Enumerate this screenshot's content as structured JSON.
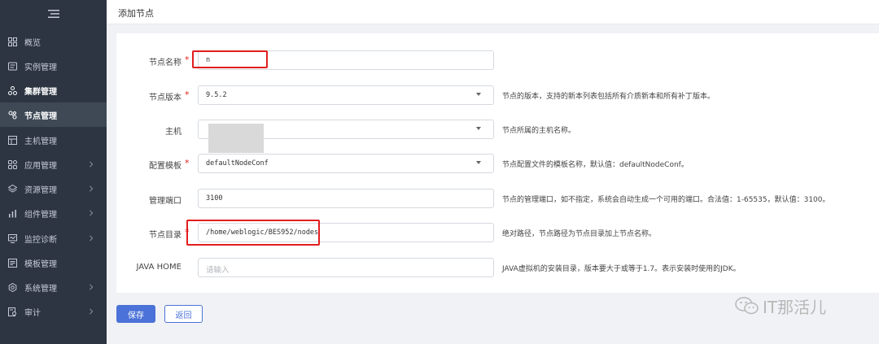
{
  "page_title": "添加节点",
  "sidebar": {
    "items": [
      {
        "label": "概览",
        "icon": "grid-icon",
        "chevron": false,
        "state": "normal"
      },
      {
        "label": "实例管理",
        "icon": "instance-icon",
        "chevron": false,
        "state": "normal"
      },
      {
        "label": "集群管理",
        "icon": "cluster-icon",
        "chevron": false,
        "state": "bold"
      },
      {
        "label": "节点管理",
        "icon": "node-icon",
        "chevron": false,
        "state": "active"
      },
      {
        "label": "主机管理",
        "icon": "host-icon",
        "chevron": false,
        "state": "normal"
      },
      {
        "label": "应用管理",
        "icon": "apps-icon",
        "chevron": true,
        "state": "normal"
      },
      {
        "label": "资源管理",
        "icon": "layers-icon",
        "chevron": true,
        "state": "normal"
      },
      {
        "label": "组件管理",
        "icon": "component-icon",
        "chevron": true,
        "state": "normal"
      },
      {
        "label": "监控诊断",
        "icon": "monitor-icon",
        "chevron": true,
        "state": "normal"
      },
      {
        "label": "模板管理",
        "icon": "template-icon",
        "chevron": false,
        "state": "normal"
      },
      {
        "label": "系统管理",
        "icon": "gear-icon",
        "chevron": true,
        "state": "normal"
      },
      {
        "label": "审计",
        "icon": "audit-icon",
        "chevron": true,
        "state": "normal"
      }
    ]
  },
  "form": {
    "node_name": {
      "label": "节点名称",
      "required": "*",
      "value": "n"
    },
    "node_version": {
      "label": "节点版本",
      "required": "*",
      "value": "9.5.2",
      "help": "节点的版本，支持的新本列表包括所有介质新本和所有补丁版本。"
    },
    "host": {
      "label": "主机",
      "value": "",
      "help": "节点所属的主机名称。"
    },
    "config_template": {
      "label": "配置模板",
      "required": "*",
      "value": "defaultNodeConf",
      "help": "节点配置文件的模板名称，默认值：defaultNodeConf。"
    },
    "admin_port": {
      "label": "管理端口",
      "value": "3100",
      "help": "节点的管理端口，如不指定，系统会自动生成一个可用的端口。合法值：1-65535，默认值：3100。"
    },
    "node_dir": {
      "label": "节点目录",
      "required": "*",
      "value": "/home/weblogic/BES952/nodes",
      "help": "绝对路径，节点路径为节点目录加上节点名称。"
    },
    "java_home": {
      "label": "JAVA HOME",
      "placeholder": "请输入",
      "help": "JAVA虚拟机的安装目录，版本要大于或等于1.7。表示安装时使用的JDK。"
    }
  },
  "buttons": {
    "save": "保存",
    "back": "返回"
  },
  "watermark": {
    "text": "IT那活儿",
    "icon": "wechat-icon"
  },
  "colors": {
    "sidebar_bg": "#2d3542",
    "active_bg": "#3f4956",
    "primary": "#4b72d8",
    "highlight": "#e21d1d",
    "required": "#e02424"
  }
}
